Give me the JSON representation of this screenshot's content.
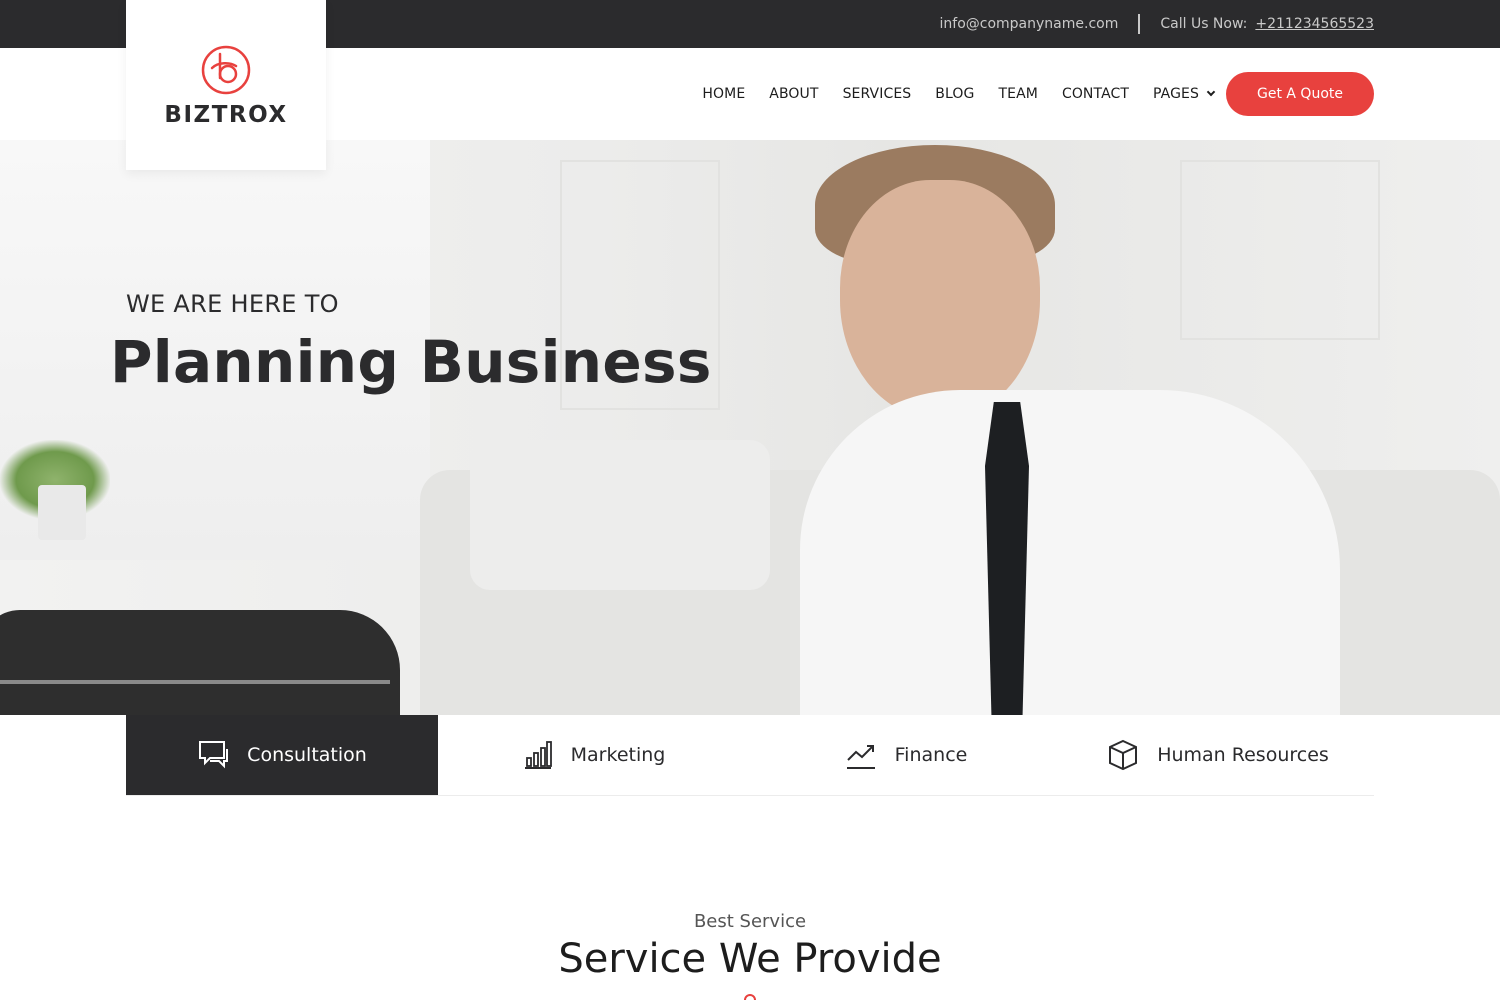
{
  "topbar": {
    "email": "info@companyname.com",
    "phone_label": "Call Us Now:",
    "phone": "+211234565523"
  },
  "brand": {
    "name": "BIZTROX",
    "accent_color": "#e8413e",
    "dark_color": "#2b2b2d"
  },
  "nav": {
    "items": [
      "HOME",
      "ABOUT",
      "SERVICES",
      "BLOG",
      "TEAM",
      "CONTACT",
      "PAGES"
    ],
    "quote_button": "Get A Quote"
  },
  "hero": {
    "subtitle": "WE ARE HERE TO",
    "title": "Planning Business"
  },
  "service_tabs": [
    {
      "label": "Consultation",
      "icon": "chat-bubbles-icon",
      "active": true
    },
    {
      "label": "Marketing",
      "icon": "bar-chart-icon",
      "active": false
    },
    {
      "label": "Finance",
      "icon": "trending-up-icon",
      "active": false
    },
    {
      "label": "Human Resources",
      "icon": "box-icon",
      "active": false
    }
  ],
  "section": {
    "subtitle": "Best Service",
    "title": "Service We Provide"
  }
}
